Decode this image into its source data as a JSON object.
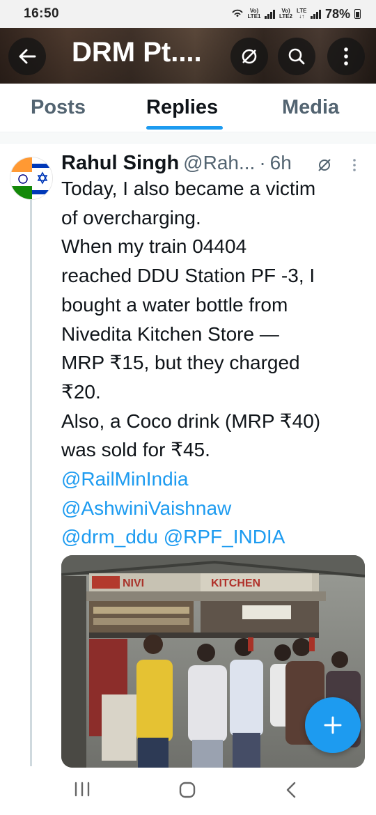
{
  "status_bar": {
    "time": "16:50",
    "sim1_top": "Vo)",
    "sim1_bottom": "LTE1",
    "sim2_top": "Vo)",
    "sim2_bottom": "LTE2",
    "network_top": "LTE",
    "network_bottom": "↓↑",
    "battery_percent": "78%",
    "icons": [
      "hotspot-icon",
      "signal-icon",
      "battery-icon"
    ]
  },
  "header": {
    "title": "DRM Pt....",
    "icons": [
      "back-arrow-icon",
      "mute-icon",
      "search-icon",
      "more-vertical-icon"
    ]
  },
  "tabs": [
    {
      "label": "Posts",
      "selected": false
    },
    {
      "label": "Replies",
      "selected": true
    },
    {
      "label": "Media",
      "selected": false
    }
  ],
  "tweet": {
    "author_name": "Rahul Singh",
    "author_handle": "@Rah...",
    "separator": "·",
    "time_ago": "6h",
    "lines": [
      "Today, I also became a victim",
      "of overcharging.",
      "When my train 04404",
      "reached DDU Station PF -3, I",
      "bought a water bottle from",
      "Nivedita Kitchen Store —",
      "MRP ₹15, but they charged",
      "₹20.",
      "Also, a Coco drink (MRP ₹40)",
      "was sold for ₹45."
    ],
    "mentions": [
      "@RailMinIndia",
      "@AshwiniVaishnaw",
      "@drm_ddu @RPF_INDIA"
    ],
    "photo": {
      "sign_left": "NIVI",
      "sign_main": "KITCHEN"
    }
  },
  "fab_icon": "plus-icon",
  "colors": {
    "accent": "#1d9bf0",
    "text_primary": "#0f1419",
    "text_secondary": "#536471"
  }
}
